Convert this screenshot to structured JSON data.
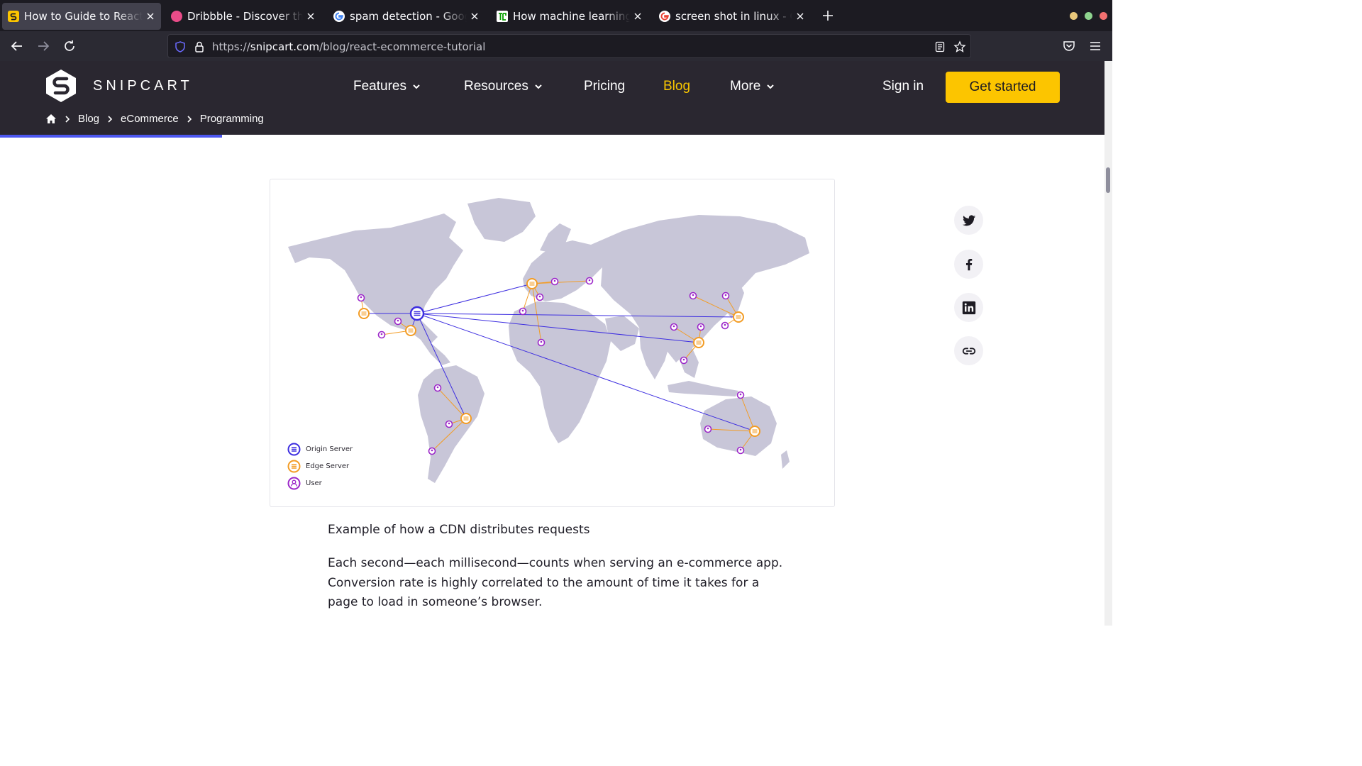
{
  "browser": {
    "tabs": [
      {
        "title": "How to Guide to React E-commerce",
        "active": true,
        "favicon": "snipcart-favicon"
      },
      {
        "title": "Dribbble - Discover the World’s Top Designers",
        "active": false,
        "favicon": "dribbble-favicon"
      },
      {
        "title": "spam detection - Google Search",
        "active": false,
        "favicon": "google-favicon"
      },
      {
        "title": "How machine learning removes spam",
        "active": false,
        "favicon": "tc-favicon"
      },
      {
        "title": "screen shot in linux - Google Search",
        "active": false,
        "favicon": "google-favicon"
      }
    ],
    "url": {
      "scheme": "https://",
      "host": "snipcart.com",
      "path": "/blog/react-ecommerce-tutorial"
    }
  },
  "site": {
    "brand": "SNIPCART",
    "nav": {
      "features": "Features",
      "resources": "Resources",
      "pricing": "Pricing",
      "blog": "Blog",
      "more": "More"
    },
    "sign_in": "Sign in",
    "get_started": "Get started",
    "breadcrumb": [
      "Blog",
      "eCommerce",
      "Programming"
    ],
    "colors": {
      "accent": "#fcc500",
      "header_bg": "#2a2730",
      "progress": "#4c57f0"
    }
  },
  "figure": {
    "legend": {
      "origin": "Origin Server",
      "edge": "Edge Server",
      "user": "User"
    },
    "colors": {
      "origin": "#3d2ee0",
      "edge": "#f39c24",
      "user": "#9c27c9",
      "land": "#c8c6d8"
    }
  },
  "article": {
    "caption": "Example of how a CDN distributes requests",
    "paragraph_lines": [
      "Each second—each millisecond—counts when serving an e-commerce app.",
      "Conversion rate is highly correlated to the amount of time it takes for a",
      "page to load in someone’s browser."
    ]
  },
  "share": [
    "twitter-icon",
    "facebook-icon",
    "linkedin-icon",
    "link-icon"
  ]
}
